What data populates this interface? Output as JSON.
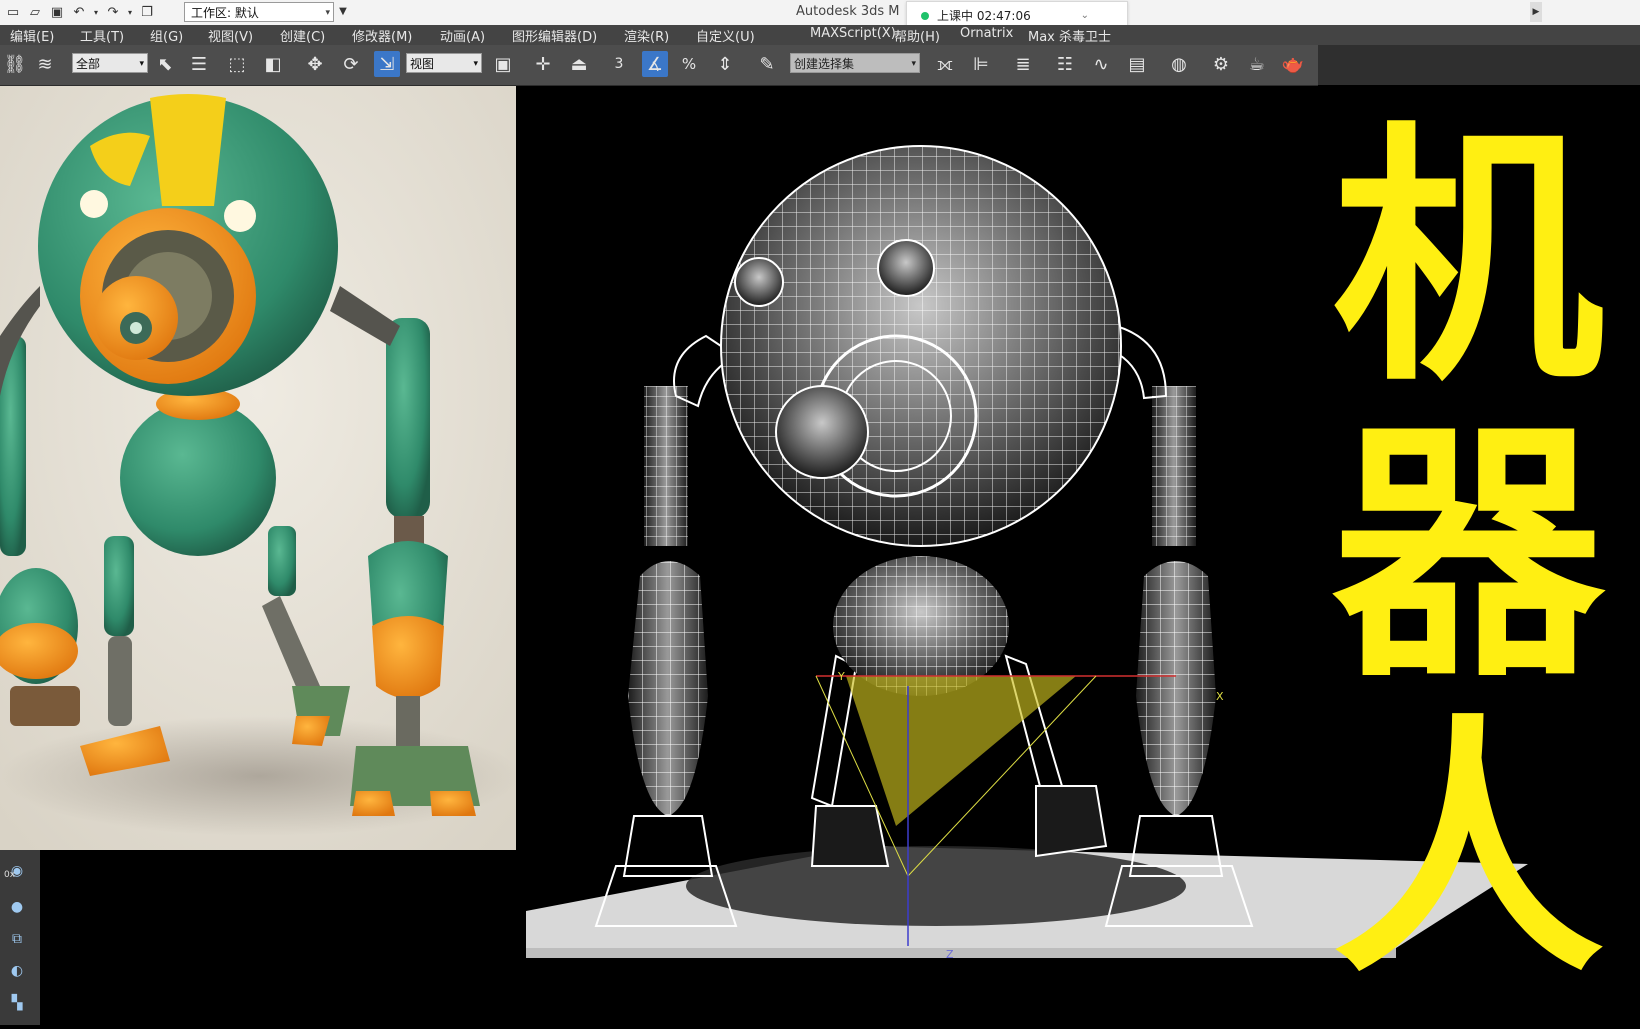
{
  "titlebar": {
    "quick_access": [
      "new-icon",
      "open-icon",
      "save-icon",
      "undo-icon",
      "dropdown-icon",
      "redo-icon",
      "dropdown-icon",
      "project-icon"
    ],
    "workspace_label": "工作区: 默认",
    "app_title": "Autodesk 3ds M",
    "session_status": "上课中 02:47:06"
  },
  "menubar": {
    "items": [
      "编辑(E)",
      "工具(T)",
      "组(G)",
      "视图(V)",
      "创建(C)",
      "修改器(M)",
      "动画(A)",
      "图形编辑器(D)",
      "渲染(R)",
      "自定义(U)",
      "MAXScript(X)",
      "帮助(H)",
      "Ornatrix",
      "Max 杀毒卫士"
    ]
  },
  "toolbar": {
    "selection_filter": "全部",
    "reference_coord": "视图",
    "named_selection_placeholder": "创建选择集",
    "snap_angle_label": "3",
    "percent_snap_label": "%",
    "spinner_snap_label": "A"
  },
  "viewport": {
    "title_chars": [
      "机",
      "器",
      "人"
    ],
    "title_color": "#ffef12",
    "gizmo": {
      "x_label": "X",
      "y_label": "Y",
      "z_label": "Z"
    }
  },
  "command_panel": {
    "icons": [
      "material-ball-icon",
      "sphere-icon",
      "render-setup-icon",
      "teapot-icon",
      "layer-icon"
    ],
    "label_0x": "0x"
  },
  "colors": {
    "accent_blue": "#3b77c8",
    "menu_bg": "#444444",
    "toolbar_bg": "#4d4d4d",
    "robot_green": "#3c9676",
    "robot_orange": "#f7941d",
    "robot_yellow": "#f4cf1a"
  }
}
